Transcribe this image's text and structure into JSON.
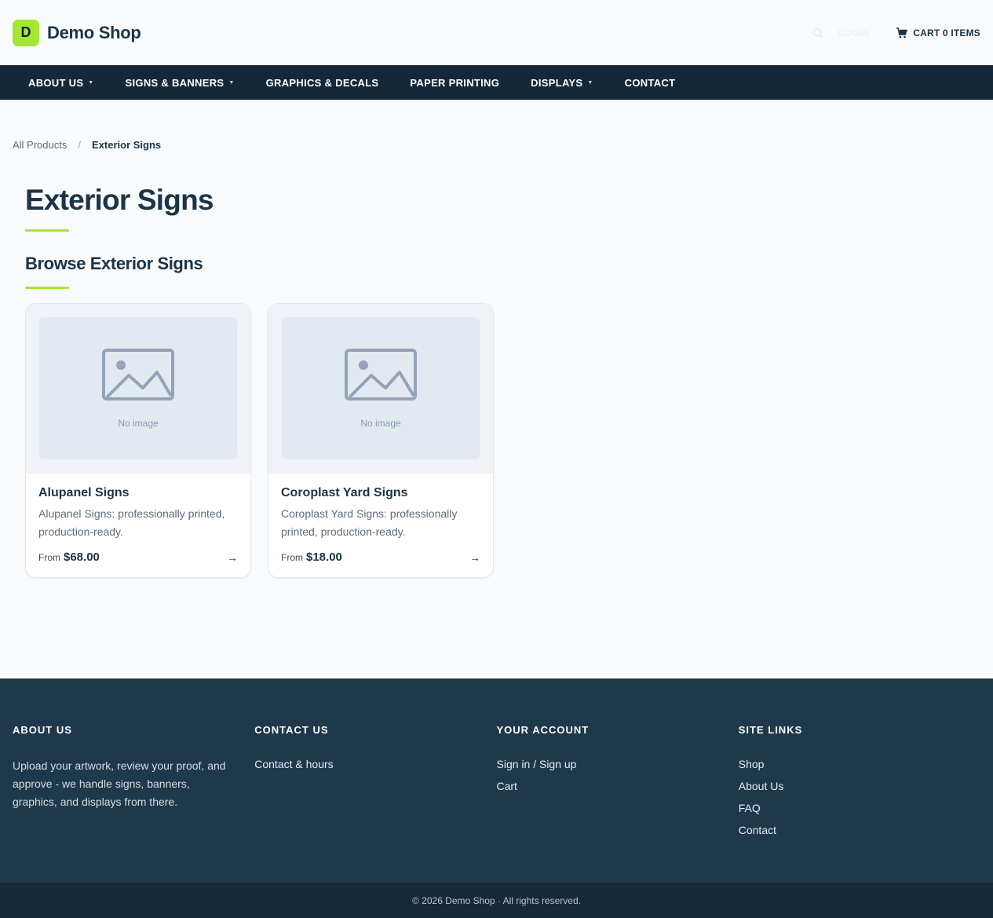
{
  "header": {
    "logo_letter": "D",
    "brand_name": "Demo Shop",
    "login_label": "LOGIN",
    "cart_label": "CART 0 ITEMS"
  },
  "nav": {
    "items": [
      {
        "label": "ABOUT US",
        "dropdown": true
      },
      {
        "label": "SIGNS & BANNERS",
        "dropdown": true
      },
      {
        "label": "GRAPHICS & DECALS",
        "dropdown": false
      },
      {
        "label": "PAPER PRINTING",
        "dropdown": false
      },
      {
        "label": "DISPLAYS",
        "dropdown": true
      },
      {
        "label": "CONTACT",
        "dropdown": false
      }
    ]
  },
  "breadcrumb": {
    "root": "All Products",
    "separator": "/",
    "current": "Exterior Signs"
  },
  "page": {
    "title": "Exterior Signs",
    "section_title": "Browse Exterior Signs",
    "accent_color": "#a3e635"
  },
  "products": [
    {
      "name": "Alupanel Signs",
      "description": "Alupanel Signs: professionally printed, production-ready.",
      "price_prefix": "From",
      "price": "$68.00",
      "no_image_label": "No image"
    },
    {
      "name": "Coroplast Yard Signs",
      "description": "Coroplast Yard Signs: professionally printed, production-ready.",
      "price_prefix": "From",
      "price": "$18.00",
      "no_image_label": "No image"
    }
  ],
  "footer": {
    "about": {
      "heading": "ABOUT US",
      "text": "Upload your artwork, review your proof, and approve - we handle signs, banners, graphics, and displays from there."
    },
    "contact": {
      "heading": "CONTACT US",
      "links": [
        "Contact & hours"
      ]
    },
    "account": {
      "heading": "YOUR ACCOUNT",
      "links": [
        "Sign in / Sign up",
        "Cart"
      ]
    },
    "site_links": {
      "heading": "SITE LINKS",
      "links": [
        "Shop",
        "About Us",
        "FAQ",
        "Contact"
      ]
    },
    "copyright": "© 2026 Demo Shop · All rights reserved."
  },
  "colors": {
    "nav_bg": "#15283a",
    "footer_bg": "#1f394c",
    "bottom_bar_bg": "#16293a",
    "text_dark": "#1b3447"
  }
}
